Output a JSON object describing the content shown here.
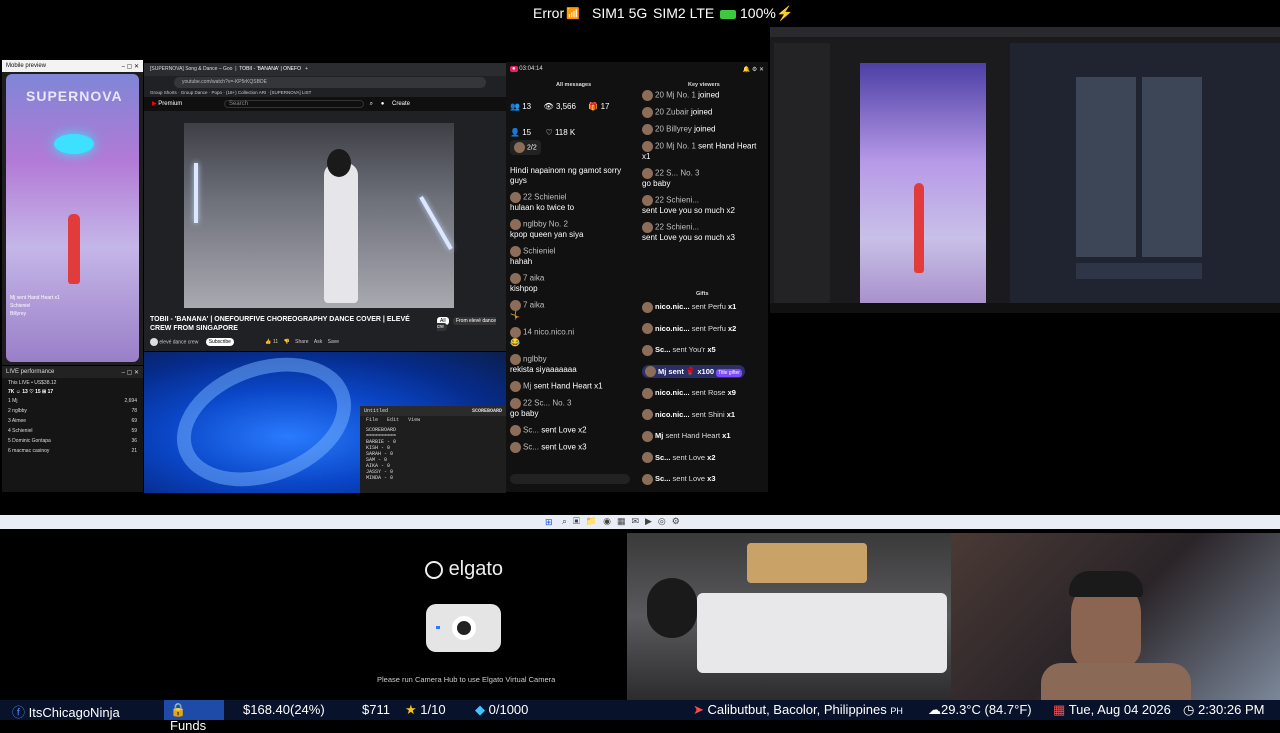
{
  "status": {
    "error": "Error",
    "sim1": "SIM1 5G",
    "sim2": "SIM2 LTE",
    "battery": "100%"
  },
  "mobile_preview": {
    "title": "Mobile preview",
    "screen_text": "SUPERNOVA",
    "chat_items": [
      "Mj",
      "sent Hand Heart",
      "x1",
      "Schieniel",
      "Billyrey"
    ]
  },
  "live_performance": {
    "title": "LIVE performance",
    "header": "This LIVE • US$38.12",
    "stats": "7K  ☺ 13  ♡ 15  ⊞ 17",
    "rows": [
      {
        "rank": "1",
        "name": "Mj",
        "value": "2,694"
      },
      {
        "rank": "2",
        "name": "nglbby",
        "value": "78"
      },
      {
        "rank": "3",
        "name": "Aimee",
        "value": "69"
      },
      {
        "rank": "4",
        "name": "Schieniel",
        "value": "59"
      },
      {
        "rank": "5",
        "name": "Dominic Gontapa",
        "value": "36"
      },
      {
        "rank": "6",
        "name": "macmac casinoy",
        "value": "21"
      }
    ]
  },
  "browser": {
    "tabs": [
      "[SUPERNOVA] Song & Dance – Goo",
      "TOBII - 'BANANA' | ONEFO",
      "+"
    ],
    "address": "youtube.com/watch?v=-KP5rKQSBDE",
    "bookmarks": [
      "Group Shorts",
      "Group Dance",
      "Popo",
      "(18+) Collection ARI",
      "[SUPERNOVA] LIST"
    ],
    "yt_brand": "Premium",
    "search_placeholder": "Search",
    "create": "Create",
    "video_title": "TOBII - 'BANANA' | ONEFOURFIVE CHOREOGRAPHY DANCE COVER | ELEVÉ CREW FROM SINGAPORE",
    "channel": "elevé dance crew",
    "subscribe": "Subscribe",
    "likes": "11",
    "share": "Share",
    "ask": "Ask",
    "save": "Save",
    "filter_all": "All",
    "filter_from": "From elevé dance cre"
  },
  "notepad": {
    "title": "Untitled",
    "menu": [
      "File",
      "Edit",
      "View"
    ],
    "tab_label": "SCOREBOARD",
    "content": "SCOREBOARD\n==========\nBARBIE - 0\nKISH - 0\nSARAH - 0\nSAM - 0\nAIKA - 0\nJASSY - 0\nMINDA - 0"
  },
  "chat": {
    "time": "03:04:14",
    "all_messages": "All messages",
    "key_viewers": "Key viewers",
    "gifts": "Gifts",
    "stats": {
      "viewers": "13",
      "views": "3,566",
      "gifts": "17",
      "shares": "15",
      "likes": "118 K"
    },
    "pinned": "2/2",
    "messages": [
      {
        "name": "",
        "text": "Hindi napainom ng gamot sorry guys"
      },
      {
        "name": "22  Schieniel",
        "text": "hulaan ko twice to"
      },
      {
        "name": "nglbby  No. 2",
        "text": "kpop queen yan siya"
      },
      {
        "name": "Schieniel",
        "text": "hahah"
      },
      {
        "name": "7  aika",
        "text": "kishpop"
      },
      {
        "name": "7  aika",
        "text": "🤸"
      },
      {
        "name": "14  nico.nico.ni",
        "text": "😂"
      },
      {
        "name": "nglbby",
        "text": "rekista siyaaaaaaa"
      },
      {
        "name": "Mj",
        "text": "sent Hand Heart x1"
      },
      {
        "name": "22  Sc...  No. 3",
        "text": "go baby"
      },
      {
        "name": "Sc...",
        "text": "sent Love x2"
      },
      {
        "name": "Sc...",
        "text": "sent Love x3"
      }
    ],
    "key_items": [
      {
        "name": "20  Mj  No. 1",
        "text": "joined"
      },
      {
        "name": "20  Zubair",
        "text": "joined"
      },
      {
        "name": "20  Billyrey",
        "text": "joined"
      },
      {
        "name": "20  Mj  No. 1",
        "text": "sent Hand Heart x1"
      },
      {
        "name": "22  S...  No. 3",
        "text": "go baby"
      },
      {
        "name": "22  Schieni...",
        "text": "sent Love you so much x2"
      },
      {
        "name": "22  Schieni...",
        "text": "sent Love you so much x3"
      }
    ],
    "gift_items": [
      {
        "name": "nico.nic...",
        "text": "sent Perfu",
        "count": "x1"
      },
      {
        "name": "nico.nic...",
        "text": "sent Perfu",
        "count": "x2"
      },
      {
        "name": "Sc...",
        "text": "sent You'r",
        "count": "x5"
      },
      {
        "name": "Mj sent",
        "text": "",
        "count": "x100",
        "tag": "Title gifter"
      },
      {
        "name": "nico.nic...",
        "text": "sent Rose",
        "count": "x9"
      },
      {
        "name": "nico.nic...",
        "text": "sent Shini",
        "count": "x1"
      },
      {
        "name": "Mj",
        "text": "sent Hand Heart",
        "count": "x1"
      },
      {
        "name": "Sc...",
        "text": "sent Love",
        "count": "x2"
      },
      {
        "name": "Sc...",
        "text": "sent Love",
        "count": "x3"
      }
    ]
  },
  "elgato": {
    "brand": "elgato",
    "message": "Please run Camera Hub to use Elgato Virtual Camera"
  },
  "bottom": {
    "channel": "ItsChicagoNinja",
    "funds_label": "Funds",
    "funds_value": "$168.40(24%)",
    "amount": "$711",
    "ratio1": "1/10",
    "ratio2": "0/1000",
    "location": "Calibutbut, Bacolor, Philippines",
    "country": "PH",
    "weather": "29.3°C (84.7°F)",
    "date": "Tue, Aug 04 2026",
    "time": "2:30:26 PM"
  },
  "colors": {
    "accent_blue": "#1e4ba8",
    "badge_blue": "#4a5ad8",
    "badge_red": "#c0203a",
    "battery_green": "#3ec83e"
  }
}
